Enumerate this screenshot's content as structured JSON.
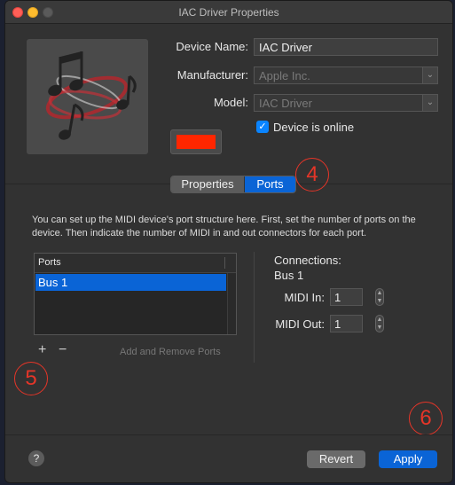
{
  "window": {
    "title": "IAC Driver Properties"
  },
  "device": {
    "name_label": "Device Name:",
    "name_value": "IAC Driver",
    "manufacturer_label": "Manufacturer:",
    "manufacturer_value": "Apple Inc.",
    "model_label": "Model:",
    "model_value": "IAC Driver",
    "online_label": "Device is online",
    "online_checked": true,
    "color": "#ff2600"
  },
  "tabs": [
    {
      "label": "Properties",
      "selected": false
    },
    {
      "label": "Ports",
      "selected": true
    }
  ],
  "annotations": {
    "a4": "4",
    "a5": "5",
    "a6": "6"
  },
  "description": "You can set up the MIDI device's port structure here. First, set the number of ports on the device. Then indicate the number of MIDI in and out connectors for each port.",
  "ports": {
    "header": "Ports",
    "rows": [
      "Bus 1"
    ],
    "add_symbol": "+",
    "remove_symbol": "−",
    "add_remove_label": "Add and Remove Ports"
  },
  "connections": {
    "title": "Connections:",
    "selected_bus": "Bus 1",
    "midi_in_label": "MIDI In:",
    "midi_in_value": "1",
    "midi_out_label": "MIDI Out:",
    "midi_out_value": "1"
  },
  "footer": {
    "help_symbol": "?",
    "revert_label": "Revert",
    "apply_label": "Apply"
  },
  "colors": {
    "accent": "#0a64d6",
    "annotation": "#e53528"
  }
}
